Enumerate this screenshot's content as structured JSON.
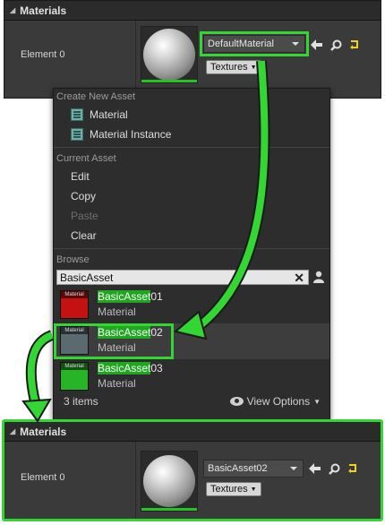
{
  "top_panel": {
    "title": "Materials",
    "element_label": "Element 0",
    "material_combo": "DefaultMaterial",
    "textures_button": "Textures"
  },
  "menu": {
    "create_section": "Create New Asset",
    "create_items": [
      "Material",
      "Material Instance"
    ],
    "current_section": "Current Asset",
    "current_items": [
      "Edit",
      "Copy",
      "Paste",
      "Clear"
    ],
    "browse_section": "Browse",
    "search_value": "BasicAsset",
    "assets": [
      {
        "name_prefix": "BasicAsset",
        "name_suffix": "01",
        "type": "Material",
        "thumb_label": "Material",
        "color": "#c41212"
      },
      {
        "name_prefix": "BasicAsset",
        "name_suffix": "02",
        "type": "Material",
        "thumb_label": "Material",
        "color": "#5a6a6e"
      },
      {
        "name_prefix": "BasicAsset",
        "name_suffix": "03",
        "type": "Material",
        "thumb_label": "Material",
        "color": "#27b527"
      }
    ],
    "items_count": "3 items",
    "view_options": "View Options"
  },
  "bottom_panel": {
    "title": "Materials",
    "element_label": "Element 0",
    "material_combo": "BasicAsset02",
    "textures_button": "Textures"
  },
  "colors": {
    "highlight_green": "#33d633",
    "search_match": "#1fa81f"
  }
}
